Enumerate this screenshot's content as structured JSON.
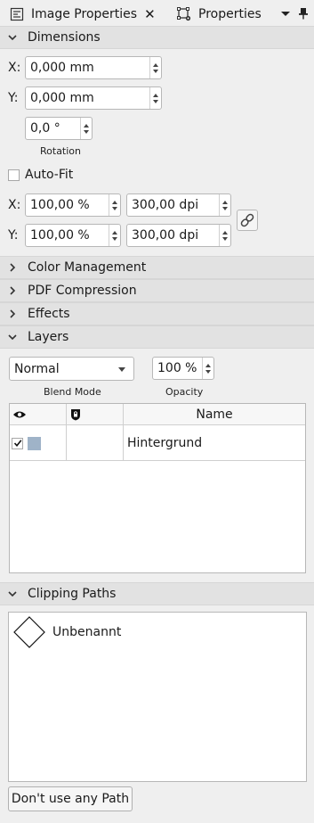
{
  "tabs": [
    {
      "label": "Image Properties",
      "icon": "image-properties-icon",
      "close": "✕"
    },
    {
      "label": "Properties",
      "icon": "properties-icon"
    }
  ],
  "sections": {
    "dimensions": "Dimensions",
    "color_management": "Color Management",
    "pdf_compression": "PDF Compression",
    "effects": "Effects",
    "layers": "Layers",
    "clipping_paths": "Clipping Paths"
  },
  "dimensions": {
    "x_label": "X:",
    "x_value": "0,000 mm",
    "y_label": "Y:",
    "y_value": "0,000 mm",
    "rotation_value": "0,0 °",
    "rotation_label": "Rotation",
    "autofit_label": "Auto-Fit",
    "autofit_checked": false,
    "scale_x_label": "X:",
    "scale_x_percent": "100,00 %",
    "scale_x_dpi": "300,00 dpi",
    "scale_y_label": "Y:",
    "scale_y_percent": "100,00 %",
    "scale_y_dpi": "300,00 dpi"
  },
  "layers": {
    "blend_mode_value": "Normal",
    "blend_mode_label": "Blend Mode",
    "opacity_value": "100 %",
    "opacity_label": "Opacity",
    "columns": {
      "name": "Name"
    },
    "rows": [
      {
        "visible": true,
        "name": "Hintergrund",
        "swatch": "#9fb3c8"
      }
    ]
  },
  "clipping_paths": {
    "items": [
      {
        "name": "Unbenannt"
      }
    ],
    "button": "Don't use any Path"
  }
}
